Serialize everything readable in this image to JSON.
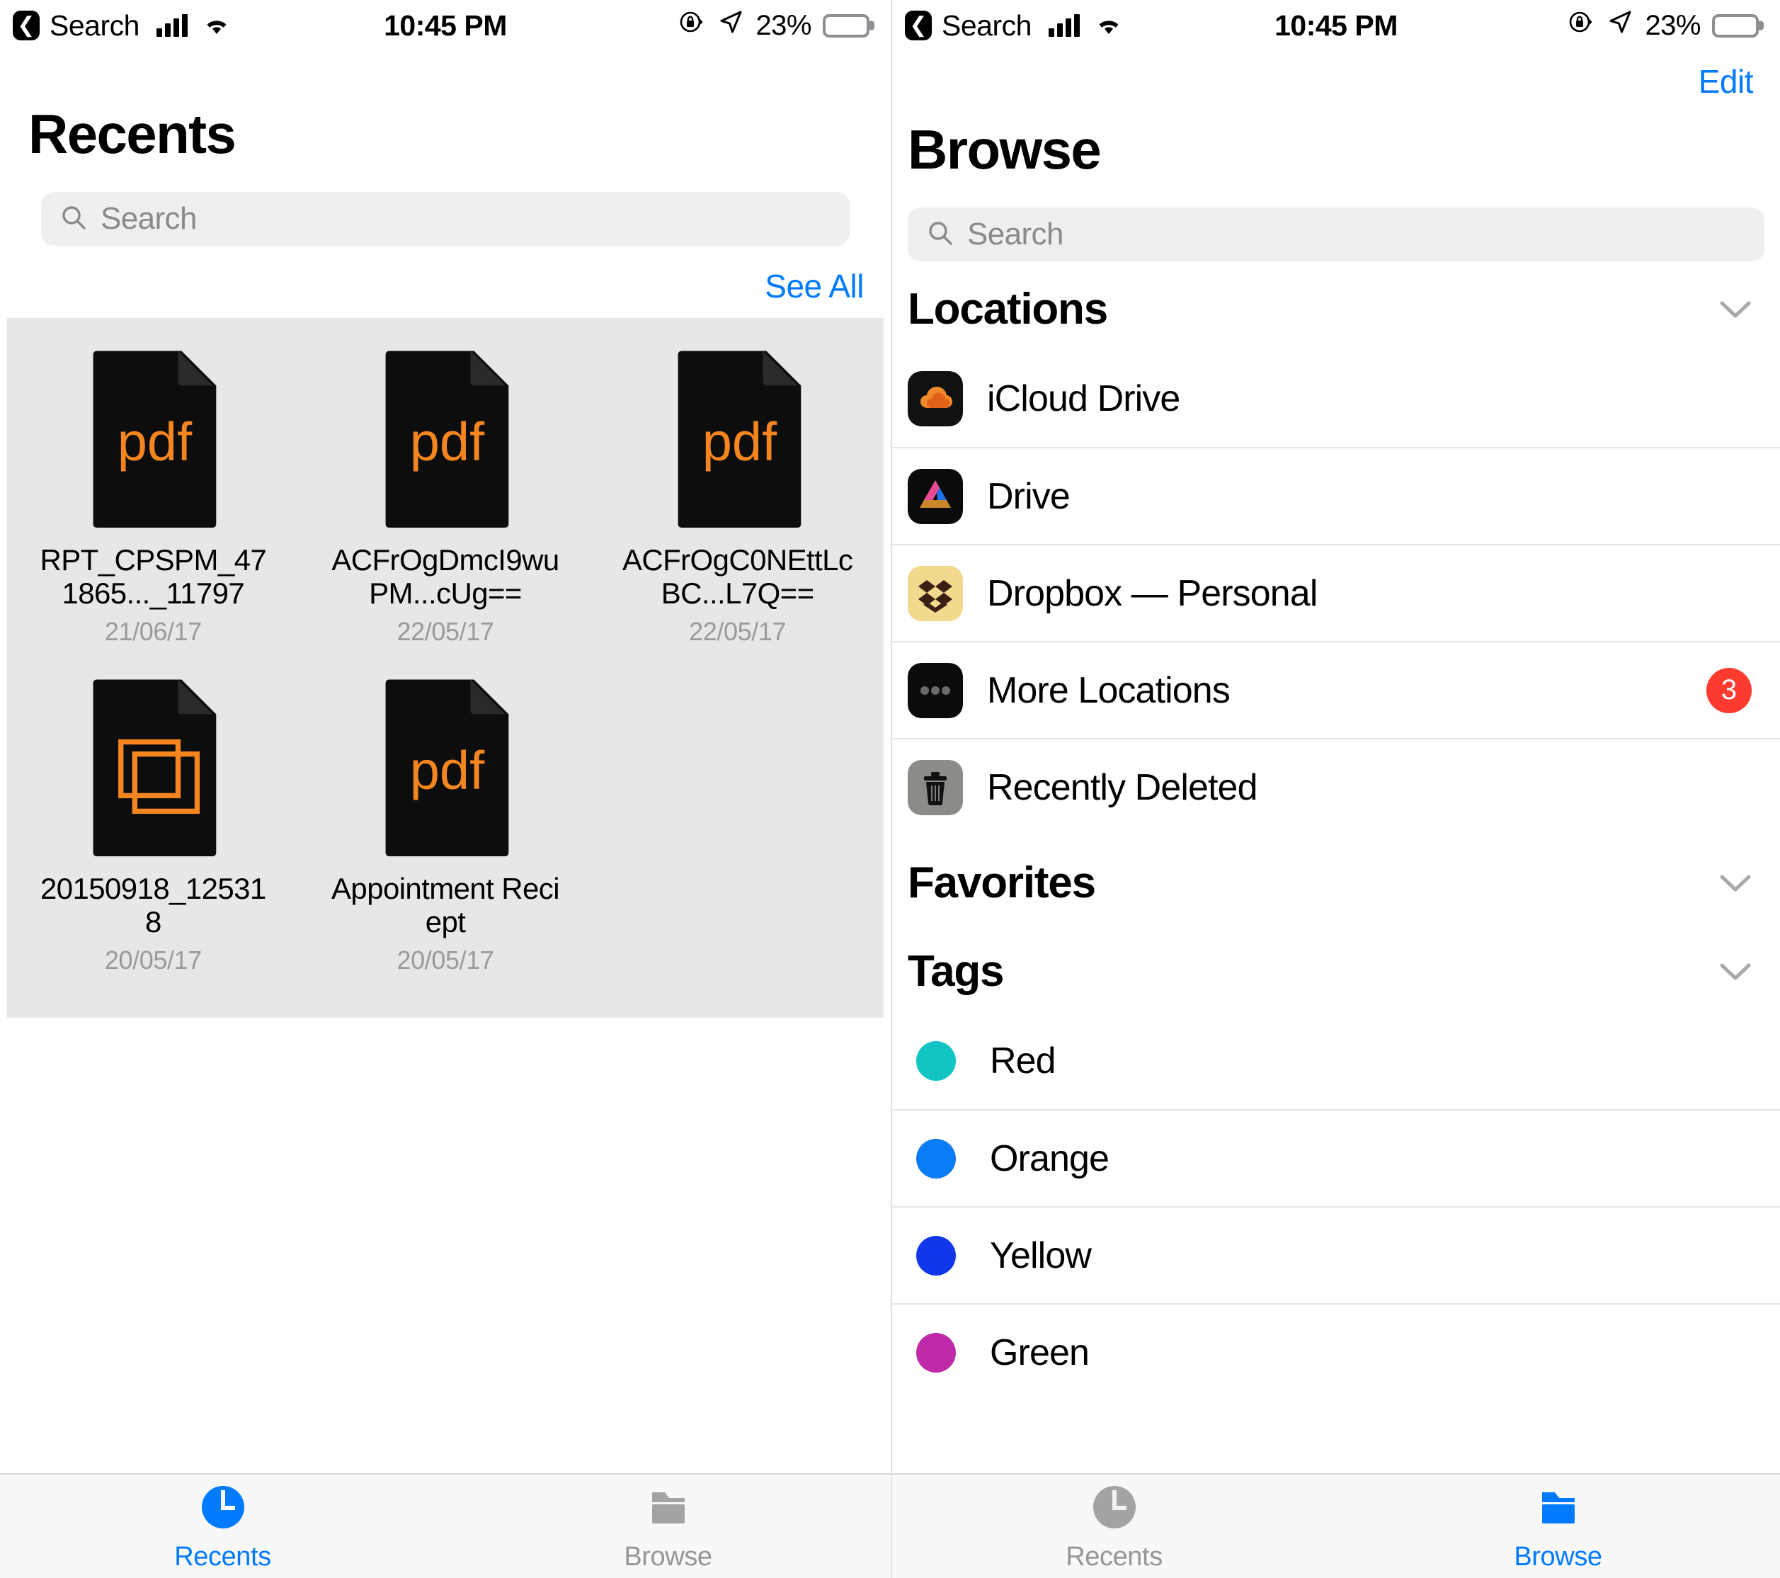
{
  "status_bar": {
    "back_label": "Search",
    "back_icon": "chevron-left-icon",
    "signal_icon": "cellular-signal-icon",
    "wifi_icon": "wifi-icon",
    "time": "10:45 PM",
    "rotation_lock_icon": "rotation-lock-icon",
    "location_icon": "location-arrow-icon",
    "battery_percent": "23%",
    "battery_level": 23
  },
  "left_screen": {
    "title": "Recents",
    "search": {
      "placeholder": "Search",
      "value": "",
      "icon": "search-icon"
    },
    "see_all_label": "See All",
    "files": [
      {
        "name": "RPT_CPSPM_471865..._11797",
        "date": "21/06/17",
        "kind": "pdf",
        "icon_label": "pdf"
      },
      {
        "name": "ACFrOgDmcI9wuPM...cUg==",
        "date": "22/05/17",
        "kind": "pdf",
        "icon_label": "pdf"
      },
      {
        "name": "ACFrOgC0NEttLcBC...L7Q==",
        "date": "22/05/17",
        "kind": "pdf",
        "icon_label": "pdf"
      },
      {
        "name": "20150918_125318",
        "date": "20/05/17",
        "kind": "image",
        "icon_label": ""
      },
      {
        "name": "Appointment Reciept",
        "date": "20/05/17",
        "kind": "pdf",
        "icon_label": "pdf"
      }
    ],
    "tabs": [
      {
        "label": "Recents",
        "icon": "clock-icon",
        "active": true
      },
      {
        "label": "Browse",
        "icon": "folder-icon",
        "active": false
      }
    ]
  },
  "right_screen": {
    "edit_label": "Edit",
    "title": "Browse",
    "search": {
      "placeholder": "Search",
      "value": "",
      "icon": "search-icon"
    },
    "sections": [
      {
        "title": "Locations",
        "collapse_icon": "chevron-down-icon",
        "rows": [
          {
            "label": "iCloud Drive",
            "icon": "icloud-drive-icon",
            "badge": ""
          },
          {
            "label": "Drive",
            "icon": "google-drive-icon",
            "badge": ""
          },
          {
            "label": "Dropbox — Personal",
            "icon": "dropbox-icon",
            "badge": ""
          },
          {
            "label": "More Locations",
            "icon": "more-ellipsis-icon",
            "badge": "3"
          },
          {
            "label": "Recently Deleted",
            "icon": "trash-icon",
            "badge": ""
          }
        ]
      },
      {
        "title": "Favorites",
        "collapse_icon": "chevron-down-icon",
        "rows": []
      },
      {
        "title": "Tags",
        "collapse_icon": "chevron-down-icon",
        "rows": [
          {
            "label": "Red",
            "dot_color": "#12c4c4"
          },
          {
            "label": "Orange",
            "dot_color": "#0a7cf5"
          },
          {
            "label": "Yellow",
            "dot_color": "#1137ea"
          },
          {
            "label": "Green",
            "dot_color": "#c02aa8"
          }
        ]
      }
    ],
    "tabs": [
      {
        "label": "Recents",
        "icon": "clock-icon",
        "active": false
      },
      {
        "label": "Browse",
        "icon": "folder-icon",
        "active": true
      }
    ]
  },
  "colors": {
    "accent_blue": "#007aff",
    "badge_red": "#ff3b30",
    "pdf_orange": "#f5861f",
    "doc_black": "#0d0d0d",
    "inactive_gray": "#969699",
    "panel_gray": "#e7e7e7"
  }
}
